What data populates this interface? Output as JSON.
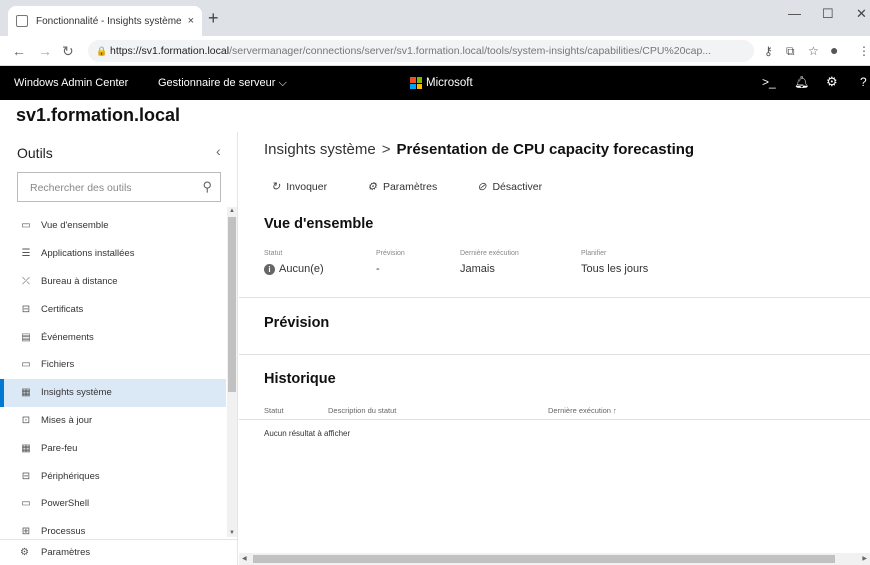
{
  "browser": {
    "tab_title": "Fonctionnalité - Insights système",
    "tab_close": "×",
    "new_tab": "+",
    "url_host": "https://sv1.formation.local",
    "url_path": "/servermanager/connections/server/sv1.formation.local/tools/system-insights/capabilities/CPU%20cap..."
  },
  "appbar": {
    "product": "Windows Admin Center",
    "menu": "Gestionnaire de serveur",
    "brand": "Microsoft"
  },
  "server_name": "sv1.formation.local",
  "sidebar": {
    "title": "Outils",
    "search_placeholder": "Rechercher des outils",
    "items": [
      {
        "label": "Vue d'ensemble",
        "icon": "monitor-icon"
      },
      {
        "label": "Applications installées",
        "icon": "list-icon"
      },
      {
        "label": "Bureau à distance",
        "icon": "remote-desktop-icon"
      },
      {
        "label": "Certificats",
        "icon": "certificate-icon"
      },
      {
        "label": "Événements",
        "icon": "events-icon"
      },
      {
        "label": "Fichiers",
        "icon": "folder-icon"
      },
      {
        "label": "Insights système",
        "icon": "insights-icon",
        "selected": true
      },
      {
        "label": "Mises à jour",
        "icon": "updates-icon"
      },
      {
        "label": "Pare-feu",
        "icon": "firewall-icon"
      },
      {
        "label": "Périphériques",
        "icon": "devices-icon"
      },
      {
        "label": "PowerShell",
        "icon": "powershell-icon"
      },
      {
        "label": "Processus",
        "icon": "process-icon"
      }
    ],
    "settings_label": "Paramètres"
  },
  "main": {
    "breadcrumb_parent": "Insights système",
    "breadcrumb_sep": ">",
    "breadcrumb_current": "Présentation de CPU capacity forecasting",
    "commands": {
      "invoke": "Invoquer",
      "settings": "Paramètres",
      "disable": "Désactiver"
    },
    "overview_title": "Vue d'ensemble",
    "overview": {
      "status_label": "Statut",
      "status_value": "Aucun(e)",
      "forecast_label": "Prévision",
      "forecast_value": "-",
      "last_run_label": "Dernière exécution",
      "last_run_value": "Jamais",
      "schedule_label": "Planifier",
      "schedule_value": "Tous les jours"
    },
    "forecast_title": "Prévision",
    "history_title": "Historique",
    "history_columns": {
      "status": "Statut",
      "description": "Description du statut",
      "last_run": "Dernière exécution ↑"
    },
    "history_empty": "Aucun résultat à afficher"
  },
  "colors": {
    "accent": "#0078d4",
    "selected_bg": "#dbe9f7",
    "appbar_bg": "#000000"
  }
}
